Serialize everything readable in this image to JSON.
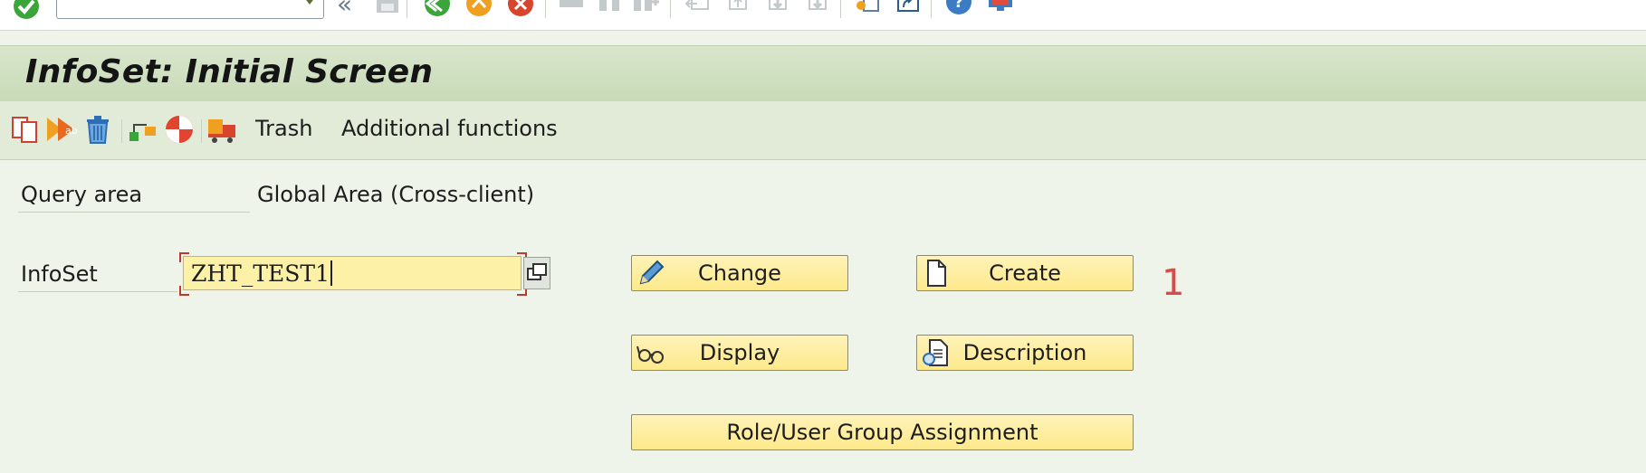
{
  "system_toolbar": {
    "command_field_value": "",
    "icons": [
      "enter-check-icon",
      "back-double-chevron-icon",
      "save-icon",
      "back-icon",
      "exit-icon",
      "cancel-icon",
      "print-icon",
      "find-icon",
      "find-next-icon",
      "first-page-icon",
      "previous-page-icon",
      "next-page-icon",
      "last-page-icon",
      "create-session-icon",
      "shortcut-icon",
      "help-icon",
      "customize-layout-icon"
    ]
  },
  "title": "InfoSet: Initial Screen",
  "app_toolbar": {
    "trash_label": "Trash",
    "additional_functions_label": "Additional functions",
    "icons": [
      "copy-icon",
      "rename-icon",
      "delete-icon",
      "where-used-icon",
      "check-icon",
      "transport-icon"
    ]
  },
  "form": {
    "query_area_label": "Query area",
    "query_area_value": "Global Area (Cross-client)",
    "infoset_label": "InfoSet",
    "infoset_value": "ZHT_TEST1"
  },
  "buttons": {
    "change": "Change",
    "create": "Create",
    "display": "Display",
    "description": "Description",
    "role_assignment": "Role/User Group Assignment"
  },
  "annotation": "1",
  "colors": {
    "title_bar": "#c7dab6",
    "toolbar": "#e2ebd8",
    "background": "#eef4e9",
    "button": "#fde98c",
    "input": "#fdf0a7",
    "annotation": "#d94a48"
  }
}
